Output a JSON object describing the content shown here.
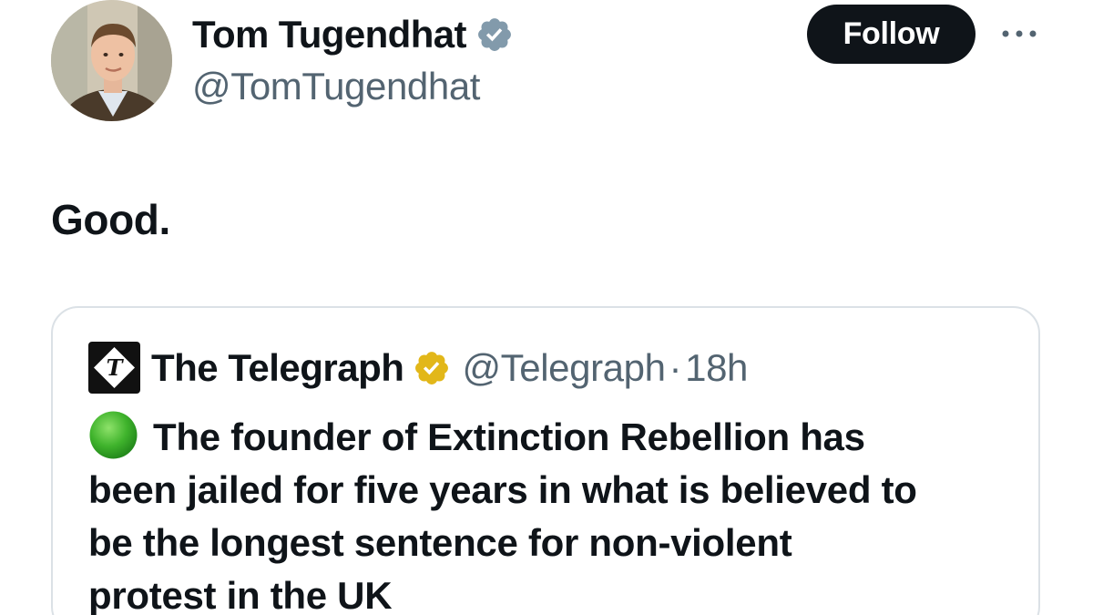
{
  "tweet": {
    "author": {
      "name": "Tom Tugendhat",
      "handle": "@TomTugendhat",
      "verified_color": "#829aab"
    },
    "follow_label": "Follow",
    "text": "Good."
  },
  "quote": {
    "author": "The Telegraph",
    "handle": "@Telegraph",
    "separator": "·",
    "time": "18h",
    "verified_color": "#e2b719",
    "status_emoji": "green-circle",
    "lines": [
      "The founder of Extinction Rebellion has",
      "been jailed for five years in what is believed to",
      "be the longest sentence for non-violent",
      "protest in the UK"
    ]
  },
  "colors": {
    "text": "#0f1419",
    "secondary": "#536471",
    "border": "#dbe1e6",
    "follow_bg": "#0f1419"
  }
}
